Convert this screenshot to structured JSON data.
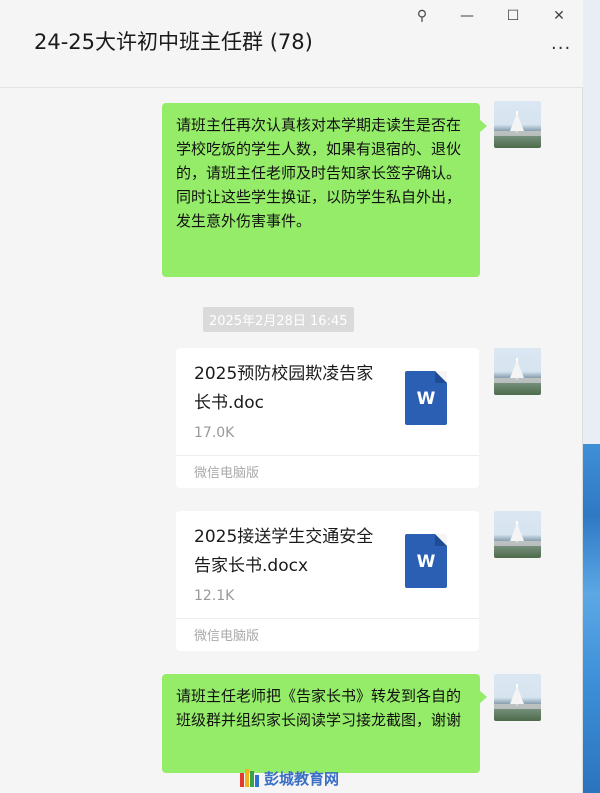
{
  "window": {
    "title": "24-25大许初中班主任群 (78)",
    "pin_icon": "pin-icon",
    "minimize_icon": "minimize-icon",
    "maximize_icon": "maximize-icon",
    "close_icon": "close-icon",
    "more_icon": "more-icon",
    "pin_glyph": "⚲",
    "minimize_glyph": "—",
    "maximize_glyph": "☐",
    "close_glyph": "✕",
    "more_glyph": "···"
  },
  "messages": [
    {
      "type": "text",
      "text": "请班主任再次认真核对本学期走读生是否在学校吃饭的学生人数，如果有退宿的、退伙的，请班主任老师及时告知家长签字确认。同时让这些学生换证，以防学生私自外出，发生意外伤害事件。"
    },
    {
      "type": "file",
      "file_name": "2025预防校园欺凌告家长书.doc",
      "file_size": "17.0K",
      "source": "微信电脑版",
      "icon_label": "W"
    },
    {
      "type": "file",
      "file_name": "2025接送学生交通安全告家长书.docx",
      "file_size": "12.1K",
      "source": "微信电脑版",
      "icon_label": "W"
    },
    {
      "type": "text",
      "text": "请班主任老师把《告家长书》转发到各自的班级群并组织家长阅读学习接龙截图，谢谢"
    }
  ],
  "timestamp": "2025年2月28日 16:45",
  "watermark": "彭城教育网",
  "colors": {
    "bubble": "#95ec69",
    "word": "#2b5fb3",
    "background": "#f5f5f5"
  }
}
